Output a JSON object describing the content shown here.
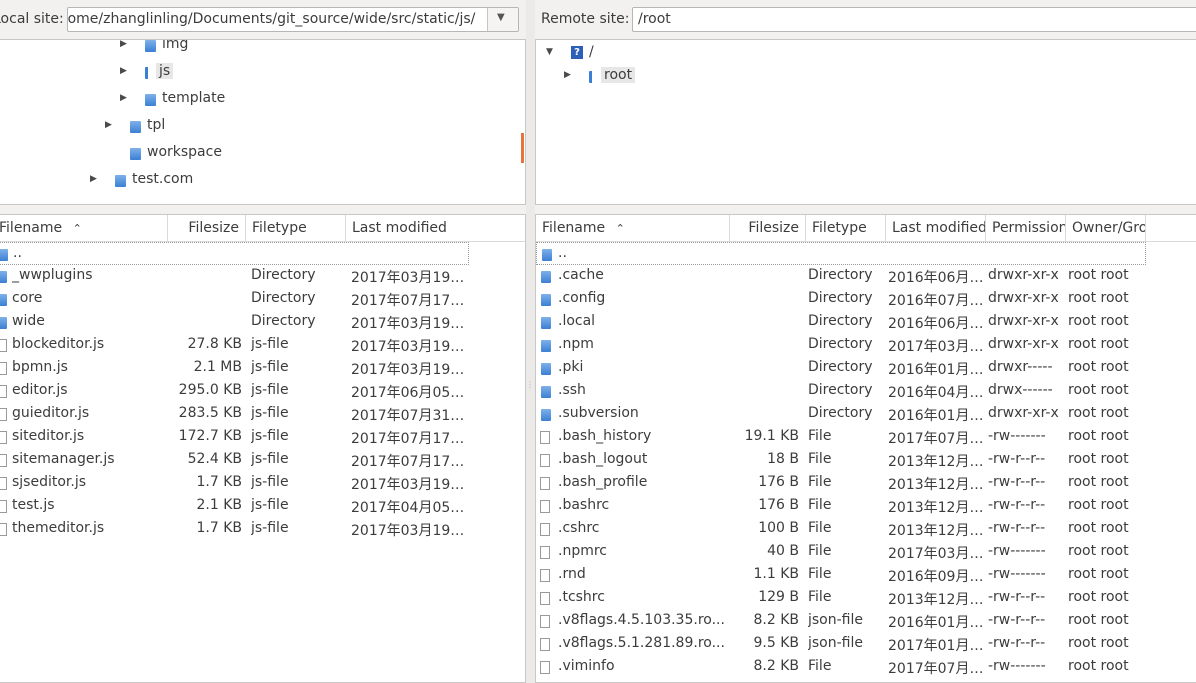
{
  "local": {
    "site_label": "Local site:",
    "path": "/home/zhanglinling/Documents/git_source/wide/src/static/js/",
    "tree": [
      {
        "label": "img",
        "expander": true,
        "icon": "folder"
      },
      {
        "label": "js",
        "expander": true,
        "icon": "folder-open",
        "selected": true
      },
      {
        "label": "template",
        "expander": true,
        "icon": "folder"
      },
      {
        "label": "tpl",
        "expander": true,
        "icon": "folder"
      },
      {
        "label": "workspace",
        "expander": false,
        "icon": "folder"
      },
      {
        "label": "test.com",
        "expander": true,
        "icon": "folder"
      }
    ],
    "columns": [
      "Filename",
      "Filesize",
      "Filetype",
      "Last modified"
    ],
    "parent_row": "..",
    "files": [
      {
        "name": "_wwplugins",
        "size": "",
        "type": "Directory",
        "modified": "2017年03月19…",
        "icon": "folder"
      },
      {
        "name": "core",
        "size": "",
        "type": "Directory",
        "modified": "2017年07月17…",
        "icon": "folder"
      },
      {
        "name": "wide",
        "size": "",
        "type": "Directory",
        "modified": "2017年03月19…",
        "icon": "folder"
      },
      {
        "name": "blockeditor.js",
        "size": "27.8 KB",
        "type": "js-file",
        "modified": "2017年03月19…",
        "icon": "file"
      },
      {
        "name": "bpmn.js",
        "size": "2.1 MB",
        "type": "js-file",
        "modified": "2017年03月19…",
        "icon": "file"
      },
      {
        "name": "editor.js",
        "size": "295.0 KB",
        "type": "js-file",
        "modified": "2017年06月05…",
        "icon": "file"
      },
      {
        "name": "guieditor.js",
        "size": "283.5 KB",
        "type": "js-file",
        "modified": "2017年07月31…",
        "icon": "file"
      },
      {
        "name": "siteditor.js",
        "size": "172.7 KB",
        "type": "js-file",
        "modified": "2017年07月17…",
        "icon": "file"
      },
      {
        "name": "sitemanager.js",
        "size": "52.4 KB",
        "type": "js-file",
        "modified": "2017年07月17…",
        "icon": "file"
      },
      {
        "name": "sjseditor.js",
        "size": "1.7 KB",
        "type": "js-file",
        "modified": "2017年03月19…",
        "icon": "file"
      },
      {
        "name": "test.js",
        "size": "2.1 KB",
        "type": "js-file",
        "modified": "2017年04月05…",
        "icon": "file"
      },
      {
        "name": "themeditor.js",
        "size": "1.7 KB",
        "type": "js-file",
        "modified": "2017年03月19…",
        "icon": "file"
      }
    ]
  },
  "remote": {
    "site_label": "Remote site:",
    "path": "/root",
    "tree_root": "/",
    "tree_root_icon": "?",
    "tree": [
      {
        "label": "root",
        "expander": true,
        "icon": "folder-open",
        "selected": true
      }
    ],
    "columns": [
      "Filename",
      "Filesize",
      "Filetype",
      "Last modified",
      "Permission",
      "Owner/Gro"
    ],
    "parent_row": "..",
    "files": [
      {
        "name": ".cache",
        "size": "",
        "type": "Directory",
        "modified": "2016年06月…",
        "perm": "drwxr-xr-x",
        "owner": "root root",
        "icon": "folder"
      },
      {
        "name": ".config",
        "size": "",
        "type": "Directory",
        "modified": "2016年07月…",
        "perm": "drwxr-xr-x",
        "owner": "root root",
        "icon": "folder"
      },
      {
        "name": ".local",
        "size": "",
        "type": "Directory",
        "modified": "2016年06月…",
        "perm": "drwxr-xr-x",
        "owner": "root root",
        "icon": "folder"
      },
      {
        "name": ".npm",
        "size": "",
        "type": "Directory",
        "modified": "2017年03月…",
        "perm": "drwxr-xr-x",
        "owner": "root root",
        "icon": "folder"
      },
      {
        "name": ".pki",
        "size": "",
        "type": "Directory",
        "modified": "2016年01月…",
        "perm": "drwxr-----",
        "owner": "root root",
        "icon": "folder"
      },
      {
        "name": ".ssh",
        "size": "",
        "type": "Directory",
        "modified": "2016年04月…",
        "perm": "drwx------",
        "owner": "root root",
        "icon": "folder"
      },
      {
        "name": ".subversion",
        "size": "",
        "type": "Directory",
        "modified": "2016年01月…",
        "perm": "drwxr-xr-x",
        "owner": "root root",
        "icon": "folder"
      },
      {
        "name": ".bash_history",
        "size": "19.1 KB",
        "type": "File",
        "modified": "2017年07月…",
        "perm": "-rw-------",
        "owner": "root root",
        "icon": "file"
      },
      {
        "name": ".bash_logout",
        "size": "18 B",
        "type": "File",
        "modified": "2013年12月…",
        "perm": "-rw-r--r--",
        "owner": "root root",
        "icon": "file"
      },
      {
        "name": ".bash_profile",
        "size": "176 B",
        "type": "File",
        "modified": "2013年12月…",
        "perm": "-rw-r--r--",
        "owner": "root root",
        "icon": "file"
      },
      {
        "name": ".bashrc",
        "size": "176 B",
        "type": "File",
        "modified": "2013年12月…",
        "perm": "-rw-r--r--",
        "owner": "root root",
        "icon": "file"
      },
      {
        "name": ".cshrc",
        "size": "100 B",
        "type": "File",
        "modified": "2013年12月…",
        "perm": "-rw-r--r--",
        "owner": "root root",
        "icon": "file"
      },
      {
        "name": ".npmrc",
        "size": "40 B",
        "type": "File",
        "modified": "2017年03月…",
        "perm": "-rw-------",
        "owner": "root root",
        "icon": "file"
      },
      {
        "name": ".rnd",
        "size": "1.1 KB",
        "type": "File",
        "modified": "2016年09月…",
        "perm": "-rw-------",
        "owner": "root root",
        "icon": "file"
      },
      {
        "name": ".tcshrc",
        "size": "129 B",
        "type": "File",
        "modified": "2013年12月…",
        "perm": "-rw-r--r--",
        "owner": "root root",
        "icon": "file"
      },
      {
        "name": ".v8flags.4.5.103.35.ro...",
        "size": "8.2 KB",
        "type": "json-file",
        "modified": "2016年01月…",
        "perm": "-rw-r--r--",
        "owner": "root root",
        "icon": "file"
      },
      {
        "name": ".v8flags.5.1.281.89.ro...",
        "size": "9.5 KB",
        "type": "json-file",
        "modified": "2017年01月…",
        "perm": "-rw-r--r--",
        "owner": "root root",
        "icon": "file"
      },
      {
        "name": ".viminfo",
        "size": "8.2 KB",
        "type": "File",
        "modified": "2017年07月…",
        "perm": "-rw-------",
        "owner": "root root",
        "icon": "file"
      }
    ]
  },
  "colors": {
    "accent": "#e8743b",
    "folder": "#3b7fd4",
    "selection": "#e7e7e7"
  }
}
